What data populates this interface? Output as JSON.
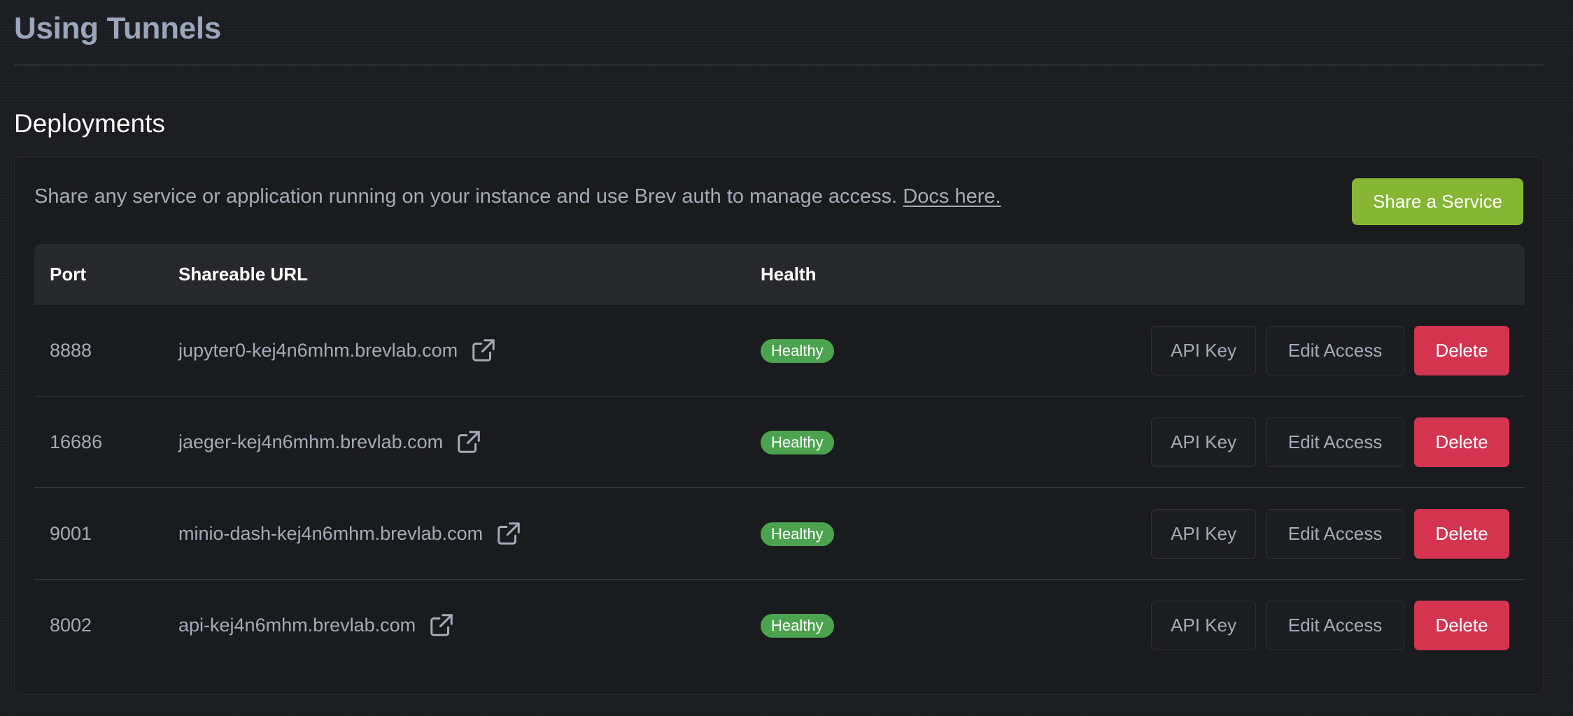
{
  "page": {
    "title": "Using Tunnels"
  },
  "deployments": {
    "title": "Deployments",
    "description": "Share any service or application running on your instance and use Brev auth to manage access.",
    "docs_link": "Docs here.",
    "share_button": "Share a Service",
    "columns": {
      "port": "Port",
      "url": "Shareable URL",
      "health": "Health"
    },
    "rows": [
      {
        "port": "8888",
        "url": "jupyter0-kej4n6mhm.brevlab.com",
        "health": "Healthy",
        "api_key": "API Key",
        "edit_access": "Edit Access",
        "delete": "Delete"
      },
      {
        "port": "16686",
        "url": "jaeger-kej4n6mhm.brevlab.com",
        "health": "Healthy",
        "api_key": "API Key",
        "edit_access": "Edit Access",
        "delete": "Delete"
      },
      {
        "port": "9001",
        "url": "minio-dash-kej4n6mhm.brevlab.com",
        "health": "Healthy",
        "api_key": "API Key",
        "edit_access": "Edit Access",
        "delete": "Delete"
      },
      {
        "port": "8002",
        "url": "api-kej4n6mhm.brevlab.com",
        "health": "Healthy",
        "api_key": "API Key",
        "edit_access": "Edit Access",
        "delete": "Delete"
      }
    ]
  },
  "icons": {
    "external_link": "external-link-icon"
  },
  "colors": {
    "background": "#1b1c1f",
    "primary_button": "#86b634",
    "healthy_badge": "#4ca34f",
    "danger_button": "#d4344f",
    "muted_text": "#a4abb8",
    "title_text": "#9aa6bb"
  }
}
